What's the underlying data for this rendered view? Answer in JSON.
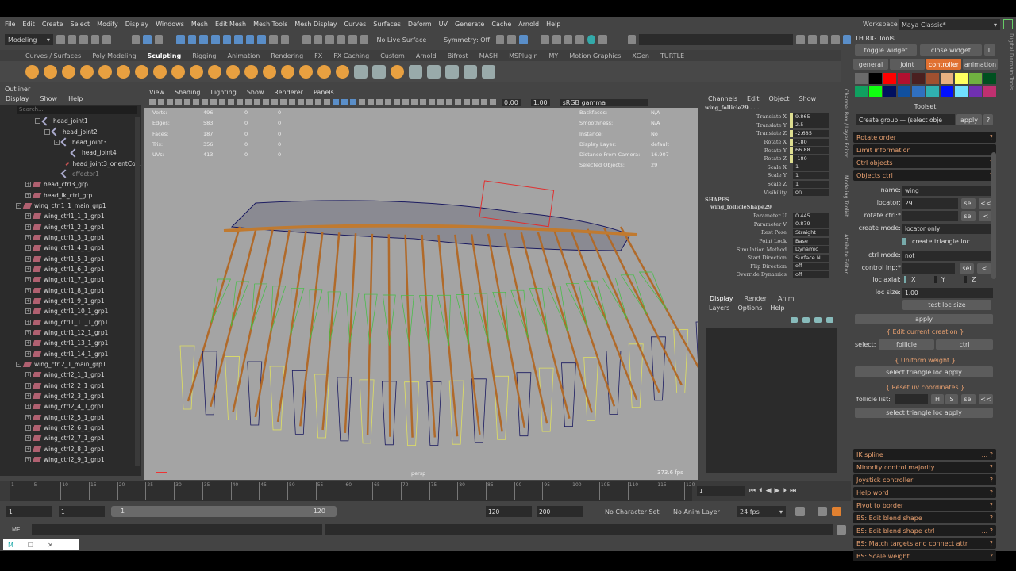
{
  "menubar": [
    "File",
    "Edit",
    "Create",
    "Select",
    "Modify",
    "Display",
    "Windows",
    "Mesh",
    "Edit Mesh",
    "Mesh Tools",
    "Mesh Display",
    "Curves",
    "Surfaces",
    "Deform",
    "UV",
    "Generate",
    "Cache",
    "Arnold",
    "Help"
  ],
  "status": {
    "mode": "Modeling",
    "live_surface": "No Live Surface",
    "symmetry": "Symmetry: Off"
  },
  "workspace": {
    "label": "Workspace :",
    "value": "Maya Classic*"
  },
  "shelf_tabs": [
    "Curves / Surfaces",
    "Poly Modeling",
    "Sculpting",
    "Rigging",
    "Animation",
    "Rendering",
    "FX",
    "FX Caching",
    "Custom",
    "Arnold",
    "Bifrost",
    "MASH",
    "MSPlugin",
    "MY",
    "Motion Graphics",
    "XGen",
    "TURTLE"
  ],
  "shelf_active": "Sculpting",
  "outliner": {
    "title": "Outliner",
    "menu": [
      "Display",
      "Show",
      "Help"
    ],
    "search_placeholder": "Search...",
    "items": [
      {
        "label": "head_joint1",
        "indent": 3,
        "type": "joint",
        "exp": "-"
      },
      {
        "label": "head_joint2",
        "indent": 4,
        "type": "joint",
        "exp": "-"
      },
      {
        "label": "head_joint3",
        "indent": 5,
        "type": "joint",
        "exp": "-"
      },
      {
        "label": "head_joint4",
        "indent": 6,
        "type": "joint",
        "exp": ""
      },
      {
        "label": "head_joint3_orientCon:",
        "indent": 6,
        "type": "constraint",
        "exp": ""
      },
      {
        "label": "effector1",
        "indent": 5,
        "type": "effector",
        "exp": ""
      },
      {
        "label": "head_ctrl3_grp1",
        "indent": 2,
        "type": "group",
        "exp": "+"
      },
      {
        "label": "head_ik_ctrl_grp",
        "indent": 2,
        "type": "group",
        "exp": "+"
      },
      {
        "label": "wing_ctrl1_1_main_grp1",
        "indent": 1,
        "type": "group",
        "exp": "-"
      },
      {
        "label": "wing_ctrl1_1_1_grp1",
        "indent": 2,
        "type": "group",
        "exp": "+"
      },
      {
        "label": "wing_ctrl1_2_1_grp1",
        "indent": 2,
        "type": "group",
        "exp": "+"
      },
      {
        "label": "wing_ctrl1_3_1_grp1",
        "indent": 2,
        "type": "group",
        "exp": "+"
      },
      {
        "label": "wing_ctrl1_4_1_grp1",
        "indent": 2,
        "type": "group",
        "exp": "+"
      },
      {
        "label": "wing_ctrl1_5_1_grp1",
        "indent": 2,
        "type": "group",
        "exp": "+"
      },
      {
        "label": "wing_ctrl1_6_1_grp1",
        "indent": 2,
        "type": "group",
        "exp": "+"
      },
      {
        "label": "wing_ctrl1_7_1_grp1",
        "indent": 2,
        "type": "group",
        "exp": "+"
      },
      {
        "label": "wing_ctrl1_8_1_grp1",
        "indent": 2,
        "type": "group",
        "exp": "+"
      },
      {
        "label": "wing_ctrl1_9_1_grp1",
        "indent": 2,
        "type": "group",
        "exp": "+"
      },
      {
        "label": "wing_ctrl1_10_1_grp1",
        "indent": 2,
        "type": "group",
        "exp": "+"
      },
      {
        "label": "wing_ctrl1_11_1_grp1",
        "indent": 2,
        "type": "group",
        "exp": "+"
      },
      {
        "label": "wing_ctrl1_12_1_grp1",
        "indent": 2,
        "type": "group",
        "exp": "+"
      },
      {
        "label": "wing_ctrl1_13_1_grp1",
        "indent": 2,
        "type": "group",
        "exp": "+"
      },
      {
        "label": "wing_ctrl1_14_1_grp1",
        "indent": 2,
        "type": "group",
        "exp": "+"
      },
      {
        "label": "wing_ctrl2_1_main_grp1",
        "indent": 1,
        "type": "group",
        "exp": "-"
      },
      {
        "label": "wing_ctrl2_1_1_grp1",
        "indent": 2,
        "type": "group",
        "exp": "+"
      },
      {
        "label": "wing_ctrl2_2_1_grp1",
        "indent": 2,
        "type": "group",
        "exp": "+"
      },
      {
        "label": "wing_ctrl2_3_1_grp1",
        "indent": 2,
        "type": "group",
        "exp": "+"
      },
      {
        "label": "wing_ctrl2_4_1_grp1",
        "indent": 2,
        "type": "group",
        "exp": "+"
      },
      {
        "label": "wing_ctrl2_5_1_grp1",
        "indent": 2,
        "type": "group",
        "exp": "+"
      },
      {
        "label": "wing_ctrl2_6_1_grp1",
        "indent": 2,
        "type": "group",
        "exp": "+"
      },
      {
        "label": "wing_ctrl2_7_1_grp1",
        "indent": 2,
        "type": "group",
        "exp": "+"
      },
      {
        "label": "wing_ctrl2_8_1_grp1",
        "indent": 2,
        "type": "group",
        "exp": "+"
      },
      {
        "label": "wing_ctrl2_9_1_grp1",
        "indent": 2,
        "type": "group",
        "exp": "+"
      }
    ]
  },
  "viewport": {
    "menu": [
      "View",
      "Shading",
      "Lighting",
      "Show",
      "Renderer",
      "Panels"
    ],
    "exposure": "0.00",
    "gamma": "1.00",
    "colorspace": "sRGB gamma",
    "hud_left": [
      [
        "Verts:",
        "496",
        "0",
        "0"
      ],
      [
        "Edges:",
        "583",
        "0",
        "0"
      ],
      [
        "Faces:",
        "187",
        "0",
        "0"
      ],
      [
        "Tris:",
        "356",
        "0",
        "0"
      ],
      [
        "UVs:",
        "413",
        "0",
        "0"
      ]
    ],
    "hud_right": [
      [
        "Backfaces:",
        "N/A"
      ],
      [
        "Smoothness:",
        "N/A"
      ],
      [
        "Instance:",
        "No"
      ],
      [
        "Display Layer:",
        "default"
      ],
      [
        "Distance From Camera:",
        "16.907"
      ],
      [
        "Selected Objects:",
        "29"
      ]
    ],
    "camera": "persp",
    "fps": "373.6 fps"
  },
  "channel_box": {
    "menu": [
      "Channels",
      "Edit",
      "Object",
      "Show"
    ],
    "object": "wing_follicle29 . . .",
    "channels": [
      {
        "l": "Translate X",
        "v": "9.865",
        "k": true
      },
      {
        "l": "Translate Y",
        "v": "2.5",
        "k": true
      },
      {
        "l": "Translate Z",
        "v": "-2.685",
        "k": true
      },
      {
        "l": "Rotate X",
        "v": "-180",
        "k": true
      },
      {
        "l": "Rotate Y",
        "v": "66.88",
        "k": true
      },
      {
        "l": "Rotate Z",
        "v": "-180",
        "k": true
      },
      {
        "l": "Scale X",
        "v": "1",
        "k": false
      },
      {
        "l": "Scale Y",
        "v": "1",
        "k": false
      },
      {
        "l": "Scale Z",
        "v": "1",
        "k": false
      },
      {
        "l": "Visibility",
        "v": "on",
        "k": false
      }
    ],
    "shapes_label": "SHAPES",
    "shape": "wing_follicleShape29",
    "shape_channels": [
      {
        "l": "Parameter U",
        "v": "0.445"
      },
      {
        "l": "Parameter V",
        "v": "0.879"
      },
      {
        "l": "Rest Pose",
        "v": "Straight"
      },
      {
        "l": "Point Lock",
        "v": "Base"
      },
      {
        "l": "Simulation Method",
        "v": "Dynamic"
      },
      {
        "l": "Start Direction",
        "v": "Surface N..."
      },
      {
        "l": "Flip Direction",
        "v": "off"
      },
      {
        "l": "Override Dynamics",
        "v": "off"
      }
    ]
  },
  "layer_editor": {
    "tabs": [
      "Display",
      "Render",
      "Anim"
    ],
    "menu": [
      "Layers",
      "Options",
      "Help"
    ]
  },
  "side_tabs": [
    "Channel Box / Layer Editor",
    "Modeling Toolkit",
    "Attribute Editor"
  ],
  "th_rig": {
    "title": "TH RIG Tools",
    "toggle": "toggle widget",
    "close": "close widget",
    "l": "L",
    "side_label": "Digital Domain Tools",
    "tabs": [
      "general",
      "joint",
      "controller",
      "animation"
    ],
    "active_tab": "controller",
    "swatches": [
      "#6b6b6b",
      "#000000",
      "#ff0000",
      "#b01030",
      "#4a2020",
      "#a05030",
      "#e8b080",
      "#ffff60",
      "#70b040",
      "#005020",
      "#10a060",
      "#10ff10",
      "#001060",
      "#1050a0",
      "#3070c0",
      "#30b0b0",
      "#0010ff",
      "#70e0ff",
      "#7030b0",
      "#c03070"
    ],
    "toolset_label": "Toolset",
    "toolset_value": "Create group — (select obje",
    "apply": "apply",
    "help": "?",
    "sections_top": [
      {
        "label": "Rotate order",
        "q": "?"
      },
      {
        "label": "Limit information",
        "q": ""
      },
      {
        "label": "Ctrl objects",
        "q": "?"
      },
      {
        "label": "Objects ctrl",
        "q": "?"
      }
    ],
    "form": {
      "name_label": "name:",
      "name_value": "wing",
      "locator_label": "locator:",
      "locator_value": "29",
      "sel": "sel",
      "back2": "<<",
      "back1": "<",
      "rotate_label": "rotate ctrl:*",
      "create_mode_label": "create mode:",
      "create_mode_value": "locator only",
      "triangle_loc": "create triangle loc",
      "ctrl_mode_label": "ctrl mode:",
      "ctrl_mode_value": "not",
      "control_inp_label": "control inp:*",
      "loc_axial_label": "loc axial:",
      "axes": [
        "X",
        "Y",
        "Z"
      ],
      "loc_size_label": "loc size:",
      "loc_size_value": "1.00",
      "test_loc": "test loc size",
      "apply": "apply"
    },
    "edit_current": "{ Edit current creation }",
    "select_label": "select:",
    "follicle": "follicle",
    "ctrl": "ctrl",
    "uniform": "{ Uniform weight }",
    "tri_apply": "select triangle loc apply",
    "reset_uv": "{ Reset uv coordinates }",
    "follicle_list": "follicle list:",
    "h": "H",
    "s": "S",
    "sections_bottom": [
      {
        "label": "IK spline",
        "q": "... ?"
      },
      {
        "label": "Minority control majority",
        "q": "?"
      },
      {
        "label": "Joystick controller",
        "q": "?"
      },
      {
        "label": "Help word",
        "q": "?"
      },
      {
        "label": "Pivot to border",
        "q": "?"
      },
      {
        "label": "BS: Edit blend shape",
        "q": "?"
      },
      {
        "label": "BS: Edit blend shape ctrl",
        "q": "... ?"
      },
      {
        "label": "BS: Match targets and connect attr",
        "q": "?"
      },
      {
        "label": "BS: Scale weight",
        "q": "?"
      }
    ]
  },
  "timeline": {
    "ticks": [
      "1",
      "5",
      "10",
      "15",
      "20",
      "25",
      "30",
      "35",
      "40",
      "45",
      "50",
      "55",
      "60",
      "65",
      "70",
      "75",
      "80",
      "85",
      "90",
      "95",
      "100",
      "105",
      "110",
      "115",
      "120"
    ],
    "current": "1"
  },
  "range": {
    "start": "1",
    "anim_start": "1",
    "slider_start": "1",
    "slider_end": "120",
    "end": "120",
    "anim_end": "200",
    "char_set": "No Character Set",
    "anim_layer": "No Anim Layer",
    "fps": "24 fps"
  },
  "mel": {
    "label": "MEL"
  },
  "colors": {
    "accent": "#e07030",
    "viewport_bg": "#a4a4a4",
    "section_text": "#e8a070"
  }
}
